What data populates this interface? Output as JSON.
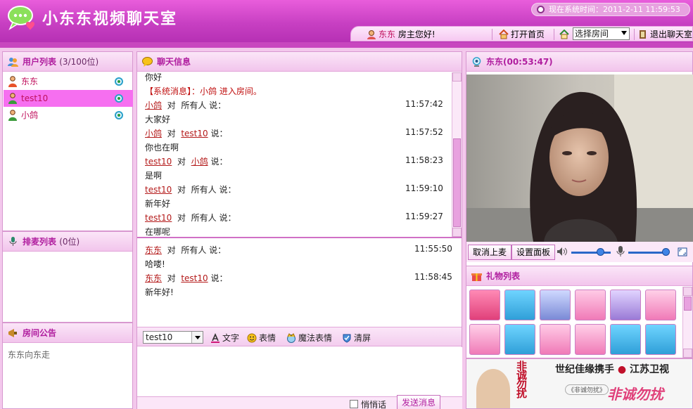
{
  "header": {
    "title": "小东东视频聊天室",
    "clock_label": "现在系统时间：2011-2-11 11:59:53",
    "greeting_name": "东东",
    "greeting_text": "房主您好!",
    "home_label": "打开首页",
    "room_select_label": "选择房间",
    "room_select_value": "",
    "exit_label": "退出聊天室"
  },
  "users_panel": {
    "title": "用户列表",
    "count": "(3/100位)",
    "users": [
      {
        "name": "东东"
      },
      {
        "name": "test10"
      },
      {
        "name": "小鸽"
      }
    ]
  },
  "queue_panel": {
    "title": "排麦列表",
    "count": "(0位)"
  },
  "notice_panel": {
    "title": "房间公告",
    "text": "东东向东走"
  },
  "chat_panel": {
    "title": "聊天信息",
    "partial_line": "你好",
    "system_msg": "【系统消息】：小鸽 进入房间。",
    "public_messages": [
      {
        "from": "小鸽",
        "to_text": "所有人",
        "to_link": "",
        "time": "11:57:42",
        "text": "大家好"
      },
      {
        "from": "小鸽",
        "to_text": "",
        "to_link": "test10",
        "time": "11:57:52",
        "text": "你也在啊"
      },
      {
        "from": "test10",
        "to_text": "",
        "to_link": "小鸽",
        "time": "11:58:23",
        "text": "是啊"
      },
      {
        "from": "test10",
        "to_text": "所有人",
        "to_link": "",
        "time": "11:59:10",
        "text": "新年好"
      },
      {
        "from": "test10",
        "to_text": "所有人",
        "to_link": "",
        "time": "11:59:27",
        "text": "在哪呢"
      }
    ],
    "private_messages": [
      {
        "from": "东东",
        "to_text": "所有人",
        "to_link": "",
        "time": "11:55:50",
        "text": "哈喽!"
      },
      {
        "from": "东东",
        "to_text": "",
        "to_link": "test10",
        "time": "11:58:45",
        "text": "新年好!"
      }
    ],
    "word_dui": "对",
    "word_shuo": "说："
  },
  "input_toolbar": {
    "target_user": "test10",
    "text_label": "文字",
    "emoticon_label": "表情",
    "magic_label": "魔法表情",
    "clear_label": "清屏",
    "whisper_label": "悄悄话",
    "send_label": "发送消息"
  },
  "video_panel": {
    "title": "东东(00:53:47)",
    "cancel_mic_label": "取消上麦",
    "settings_label": "设置面板",
    "speaker_level": 0.75,
    "mic_level": 0.95
  },
  "gift_panel": {
    "title": "礼物列表"
  },
  "banner": {
    "text1": "世纪佳缘携手",
    "text2": "江苏卫视",
    "text3": "非诚勿扰",
    "caption": "《非诚勿扰》"
  },
  "colors": {
    "primary": "#c846bf",
    "link": "#b41a1a",
    "system": "#c01010",
    "accent": "#b01e9f"
  }
}
